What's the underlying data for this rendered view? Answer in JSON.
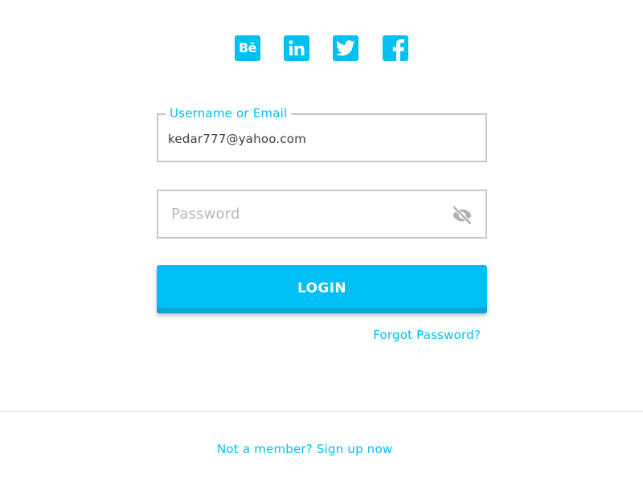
{
  "theme": {
    "accent": "#00bff3",
    "button_shadow": "#08a4d6",
    "border": "#c8c8c8"
  },
  "social": {
    "items": [
      {
        "name": "behance",
        "icon": "behance-icon",
        "text": "Bē"
      },
      {
        "name": "linkedin",
        "icon": "linkedin-icon"
      },
      {
        "name": "twitter",
        "icon": "twitter-icon"
      },
      {
        "name": "facebook",
        "icon": "facebook-icon"
      }
    ]
  },
  "login_form": {
    "username": {
      "label": "Username or Email",
      "value": "kedar777@yahoo.com"
    },
    "password": {
      "placeholder": "Password",
      "value": "",
      "toggle_icon": "eye-off-icon"
    },
    "submit_label": "LOGIN",
    "forgot_label": "Forgot Password?"
  },
  "footer": {
    "signup_text": "Not a member? Sign up now"
  }
}
